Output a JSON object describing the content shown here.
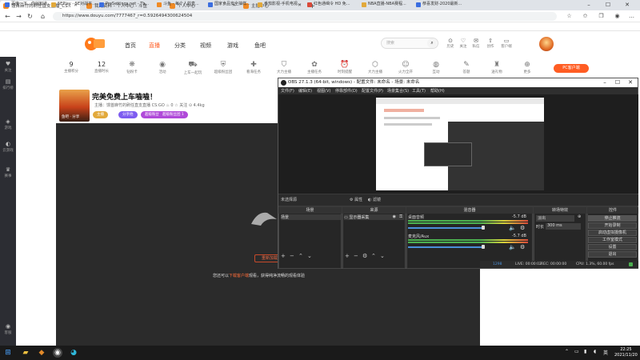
{
  "browser": {
    "tabs": [
      {
        "label": "馒首麻竹的刷任直支直播_CS:GO",
        "active": true,
        "color": "#f08a24"
      },
      {
        "label": "我的资料 - 个人中心 - 斗鱼",
        "active": false,
        "color": "#f08a24"
      },
      {
        "label": "个人中心",
        "active": false,
        "color": "#f08a24"
      },
      {
        "label": "主播中心",
        "active": false,
        "color": "#f08a24"
      }
    ],
    "url": "https://www.douyu.com/7777467_r=0.5926494300624504",
    "bookmarks": [
      {
        "label": "百度一下，你就知道",
        "color": "#3b6ee0"
      },
      {
        "label": "5EPlay - 5E对战平...",
        "color": "#e2a93b"
      },
      {
        "label": "ProSettings.net - Th...",
        "color": "#3b6ee0"
      },
      {
        "label": "斗鱼 - 每个人的直...",
        "color": "#f08a24"
      },
      {
        "label": "国家食品安全抽样...",
        "color": "#3b6ee0"
      },
      {
        "label": "番茄影视-手机电视...",
        "color": "#e2a93b"
      },
      {
        "label": "红色通缉令 HD 免...",
        "color": "#d94a3a"
      },
      {
        "label": "NBA直播-NBA赛程...",
        "color": "#e2a93b"
      },
      {
        "label": "恭喜发财-2020最新...",
        "color": "#3b6ee0"
      }
    ]
  },
  "douyu": {
    "nav": [
      "首页",
      "直播",
      "分类",
      "视频",
      "游戏",
      "鱼吧"
    ],
    "nav_active": 1,
    "search_placeholder": "搜索",
    "right_icons": [
      {
        "icon": "⊙",
        "label": "历史"
      },
      {
        "icon": "♡",
        "label": "关注"
      },
      {
        "icon": "✉",
        "label": "私信"
      },
      {
        "icon": "⇧",
        "label": "创作"
      },
      {
        "icon": "▭",
        "label": "客户端"
      }
    ],
    "sidebar": [
      {
        "icon": "♥",
        "label": "关注"
      },
      {
        "icon": "▤",
        "label": "排行榜"
      },
      {
        "icon": "◈",
        "label": "游戏"
      },
      {
        "icon": "◐",
        "label": "云游戏"
      },
      {
        "icon": "♛",
        "label": "赛事"
      },
      {
        "icon": "◉",
        "label": "客服"
      }
    ],
    "gifts": [
      {
        "icon": "9",
        "label": "主播积分"
      },
      {
        "icon": "12",
        "label": "直播时长"
      },
      {
        "icon": "❋",
        "label": "钻粉卡"
      },
      {
        "icon": "◉",
        "label": "活动"
      },
      {
        "icon": "⛟",
        "label": "上车一起玩"
      },
      {
        "icon": "⛨",
        "label": "超级粉丝团"
      },
      {
        "icon": "✚",
        "label": "看海任务"
      },
      {
        "icon": "⛉",
        "label": "大力主播"
      },
      {
        "icon": "✿",
        "label": "主播任务"
      },
      {
        "icon": "⏰",
        "label": "时刻提醒"
      },
      {
        "icon": "⬡",
        "label": "大力主播"
      },
      {
        "icon": "☺",
        "label": "火力全开"
      },
      {
        "icon": "◍",
        "label": "互动"
      },
      {
        "icon": "✎",
        "label": "答题"
      },
      {
        "icon": "♜",
        "label": "送礼物"
      },
      {
        "icon": "⊕",
        "label": "更多"
      }
    ],
    "pc_client": "PC客户端",
    "room": {
      "cover_label": "鱼吧 · 分享",
      "title": "完美免费上车嗑嗑！",
      "meta": "主播：馒首麻竹的刷任直支直播    CS:GO    ♨ 0    ☆ 关注    ⊙ 4.4kg",
      "chips": [
        {
          "label": "主播",
          "color": "#e2a93b"
        },
        {
          "label": "分享他",
          "color": "#7d5cf0"
        },
        {
          "label": "超级粉丝团 4",
          "color": "#b04ad9"
        },
        {
          "label": "超级粉丝团 1",
          "color": "#b04ad9"
        }
      ]
    },
    "player": {
      "button": "重新加载",
      "hint_pre": "您还可以",
      "hint_link": "下载客户端",
      "hint_post": "观看，获得纯净流畅的观看体验"
    }
  },
  "obs": {
    "title": "OBS 27.1.3 (64-bit, windows) - 配置文件: 未命名 - 场景: 未命名",
    "menu": [
      "文件(F)",
      "编辑(E)",
      "视图(V)",
      "停靠部件(D)",
      "配置文件(P)",
      "场景集合(S)",
      "工具(T)",
      "帮助(H)"
    ],
    "no_source": "未选择源",
    "props_btn": "属性",
    "filters_btn": "滤镜",
    "scenes_header": "场景",
    "sources_header": "来源",
    "mixer_header": "混音器",
    "transitions_header": "转场特效",
    "controls_header": "控件",
    "scene_item": "场景",
    "source_item": "显示器采集",
    "mixer": [
      {
        "name": "桌面音频",
        "db": "-5.7 dB",
        "level": 0.78
      },
      {
        "name": "麦克风/Aux",
        "db": "-5.7 dB",
        "level": 0.78
      }
    ],
    "transition": {
      "type": "淡出",
      "duration_label": "时长",
      "duration": "300 ms"
    },
    "controls": [
      "停止推流",
      "开始录制",
      "启动虚拟摄像机",
      "工作室模式",
      "设置",
      "退出"
    ],
    "status": {
      "live": "LIVE: 00:00:02",
      "rec": "REC: 00:00:00",
      "cpu": "CPU: 1.3%, 60.00 fps",
      "dropped": "1298"
    }
  },
  "taskbar": {
    "clock_time": "22:25",
    "clock_date": "2021/11/20"
  }
}
